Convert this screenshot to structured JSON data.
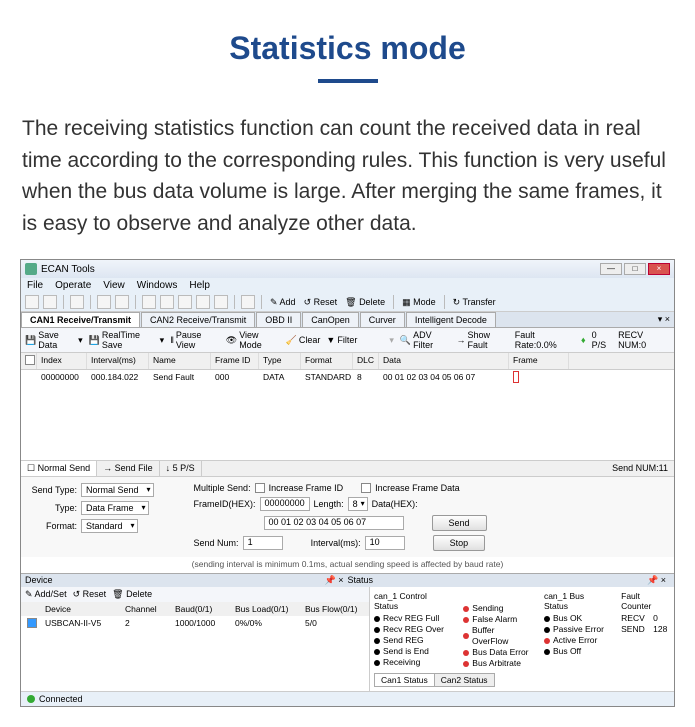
{
  "hero": {
    "title": "Statistics mode"
  },
  "desc": "The receiving statistics function can count the received data in real time according to the corresponding rules. This function is very useful when the bus data volume is large. After merging the same frames, it is easy to observe and analyze other data.",
  "win": {
    "title": "ECAN Tools"
  },
  "menu": {
    "file": "File",
    "operate": "Operate",
    "view": "View",
    "windows": "Windows",
    "help": "Help"
  },
  "toolbar": {
    "add": "Add",
    "reset": "Reset",
    "delete": "Delete",
    "mode": "Mode",
    "transfer": "Transfer"
  },
  "tabs": {
    "t1": "CAN1 Receive/Transmit",
    "t2": "CAN2 Receive/Transmit",
    "t3": "OBD II",
    "t4": "CanOpen",
    "t5": "Curver",
    "t6": "Intelligent Decode"
  },
  "subbar": {
    "save": "Save Data",
    "rt": "RealTime Save",
    "pause": "Pause View",
    "vm": "View Mode",
    "clear": "Clear",
    "filter": "Filter",
    "adv": "ADV Filter",
    "sf": "Show Fault",
    "fr": "Fault Rate:0.0%",
    "ps": "0 P/S",
    "rn": "RECV NUM:0"
  },
  "grid": {
    "h": {
      "idx": "Index",
      "int": "Interval(ms)",
      "nm": "Name",
      "fid": "Frame ID",
      "typ": "Type",
      "fmt": "Format",
      "dlc": "DLC",
      "dat": "Data",
      "frm": "Frame"
    },
    "r": {
      "idx": "00000000",
      "int": "000.184.022",
      "nm": "Send Fault",
      "fid": "000",
      "typ": "DATA",
      "fmt": "STANDARD",
      "dlc": "8",
      "dat": "00 01 02 03 04 05 06 07",
      "frm": ""
    }
  },
  "ltabs": {
    "ns": "Normal Send",
    "sf": "Send File",
    "rate": "5 P/S",
    "sn": "Send NUM:11"
  },
  "send": {
    "sendtype_l": "Send Type:",
    "sendtype_v": "Normal Send",
    "type_l": "Type:",
    "type_v": "Data Frame",
    "format_l": "Format:",
    "format_v": "Standard",
    "mult": "Multiple Send:",
    "incid": "Increase Frame ID",
    "incdata": "Increase Frame Data",
    "fid_l": "FrameID(HEX):",
    "fid_v": "00000000",
    "len_l": "Length:",
    "len_v": "8",
    "data_l": "Data(HEX):",
    "data_v": "00 01 02 03 04 05 06 07",
    "num_l": "Send Num:",
    "num_v": "1",
    "intv_l": "Interval(ms):",
    "intv_v": "10",
    "send_btn": "Send",
    "stop_btn": "Stop",
    "note": "(sending interval is minimum 0.1ms, actual sending speed is affected by baud rate)"
  },
  "device": {
    "title": "Device",
    "status": "Status",
    "add": "Add/Set",
    "reset": "Reset",
    "delete": "Delete",
    "h": {
      "dev": "Device",
      "ch": "Channel",
      "baud": "Baud(0/1)",
      "load": "Bus Load(0/1)",
      "flow": "Bus Flow(0/1)"
    },
    "r": {
      "dev": "USBCAN-II-V5",
      "ch": "2",
      "baud": "1000/1000",
      "load": "0%/0%",
      "flow": "5/0"
    }
  },
  "status": {
    "c1": "can_1 Control Status",
    "c2": "can_1 Bus Status",
    "c3": "Fault Counter",
    "s1": "Recv REG Full",
    "s2": "Recv REG Over",
    "s3": "Send REG",
    "s4": "Send is End",
    "s5": "Receiving",
    "b1": "Sending",
    "b2": "False Alarm",
    "b3": "Buffer OverFlow",
    "b4": "Bus Data Error",
    "b5": "Bus Arbitrate",
    "u1": "Bus OK",
    "u2": "Passive Error",
    "u3": "Active Error",
    "u4": "Bus Off",
    "recv": "RECV",
    "recv_v": "0",
    "send": "SEND",
    "send_v": "128",
    "t1": "Can1 Status",
    "t2": "Can2 Status"
  },
  "footer": {
    "conn": "Connected"
  }
}
